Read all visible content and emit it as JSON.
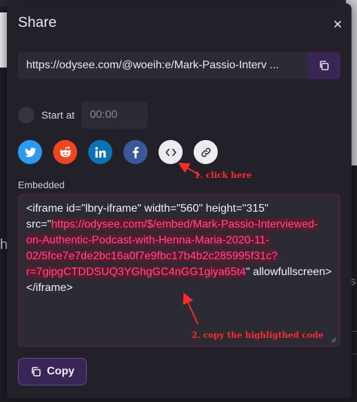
{
  "modal": {
    "title": "Share",
    "close_icon": "close-icon"
  },
  "share_url": {
    "value": "https://odysee.com/@woeih:e/Mark-Passio-Interv ...",
    "copy_icon": "copy-icon"
  },
  "start_at": {
    "label": "Start at",
    "placeholder": "00:00",
    "checked": false
  },
  "social": [
    {
      "name": "twitter",
      "icon": "twitter-icon",
      "color": "#2a9bf0"
    },
    {
      "name": "reddit",
      "icon": "reddit-icon",
      "color": "#f1461d"
    },
    {
      "name": "linkedin",
      "icon": "linkedin-icon",
      "color": "#0a73b3"
    },
    {
      "name": "facebook",
      "icon": "facebook-icon",
      "color": "#3b5998"
    },
    {
      "name": "embed",
      "icon": "code-icon",
      "color": "#ececf0"
    },
    {
      "name": "link",
      "icon": "link-icon",
      "color": "#ececf0"
    }
  ],
  "embedded": {
    "label": "Embedded",
    "code_before": "<iframe id=\"lbry-iframe\" width=\"560\" height=\"315\" src=\"",
    "code_url": "https://odysee.com/$/embed/Mark-Passio-Interviewed-on-Authentic-Podcast-with-Henna-Maria-2020-11-02/5fce7e7de2bc16a0f7e9fbc17b4b2c285995f31c?r=7gipgCTDDSUQ3YGhgGC4nGG1giya65t4",
    "code_after": "\" allowfullscreen></iframe>",
    "highlight_color": "#ff4c8c"
  },
  "copy_button": {
    "label": "Copy",
    "icon": "copy-icon"
  },
  "annotations": {
    "step1": "1. click here",
    "step2": "2. copy the highligthed code",
    "color": "#ff2b2b"
  },
  "background": {
    "left_text": "h",
    "right_text": "S"
  }
}
